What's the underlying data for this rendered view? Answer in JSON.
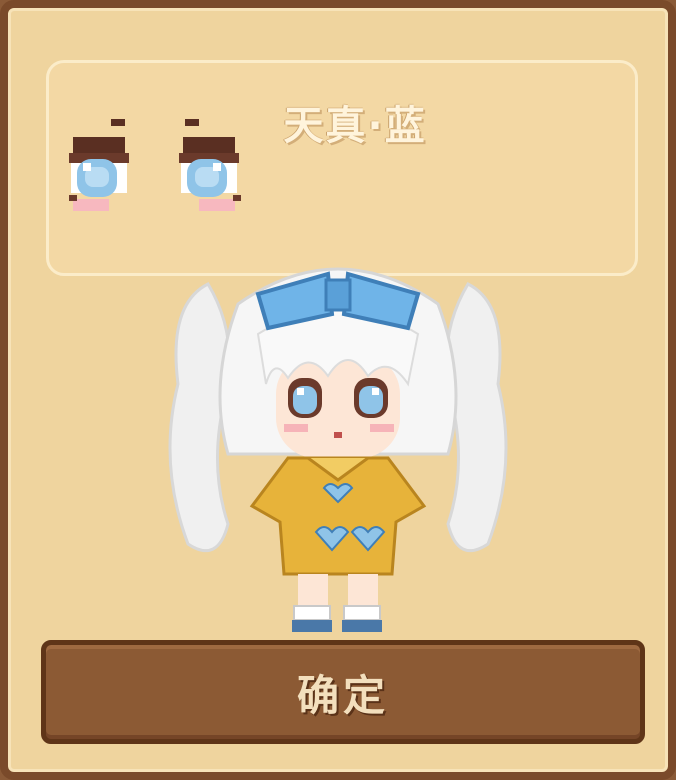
{
  "dialog": {
    "outfit_name": "天真·蓝",
    "confirm_label": "确定"
  },
  "icons": {
    "eyes_preview": "eyes-icon",
    "character": "character-preview"
  },
  "colors": {
    "frame": "#7a4a2a",
    "panel": "#efd49e",
    "button": "#8c5a34",
    "eye_iris": "#8fc4e8",
    "hair": "#f2f2f2",
    "ribbon": "#6fb4e8",
    "dress": "#e7b33a"
  }
}
